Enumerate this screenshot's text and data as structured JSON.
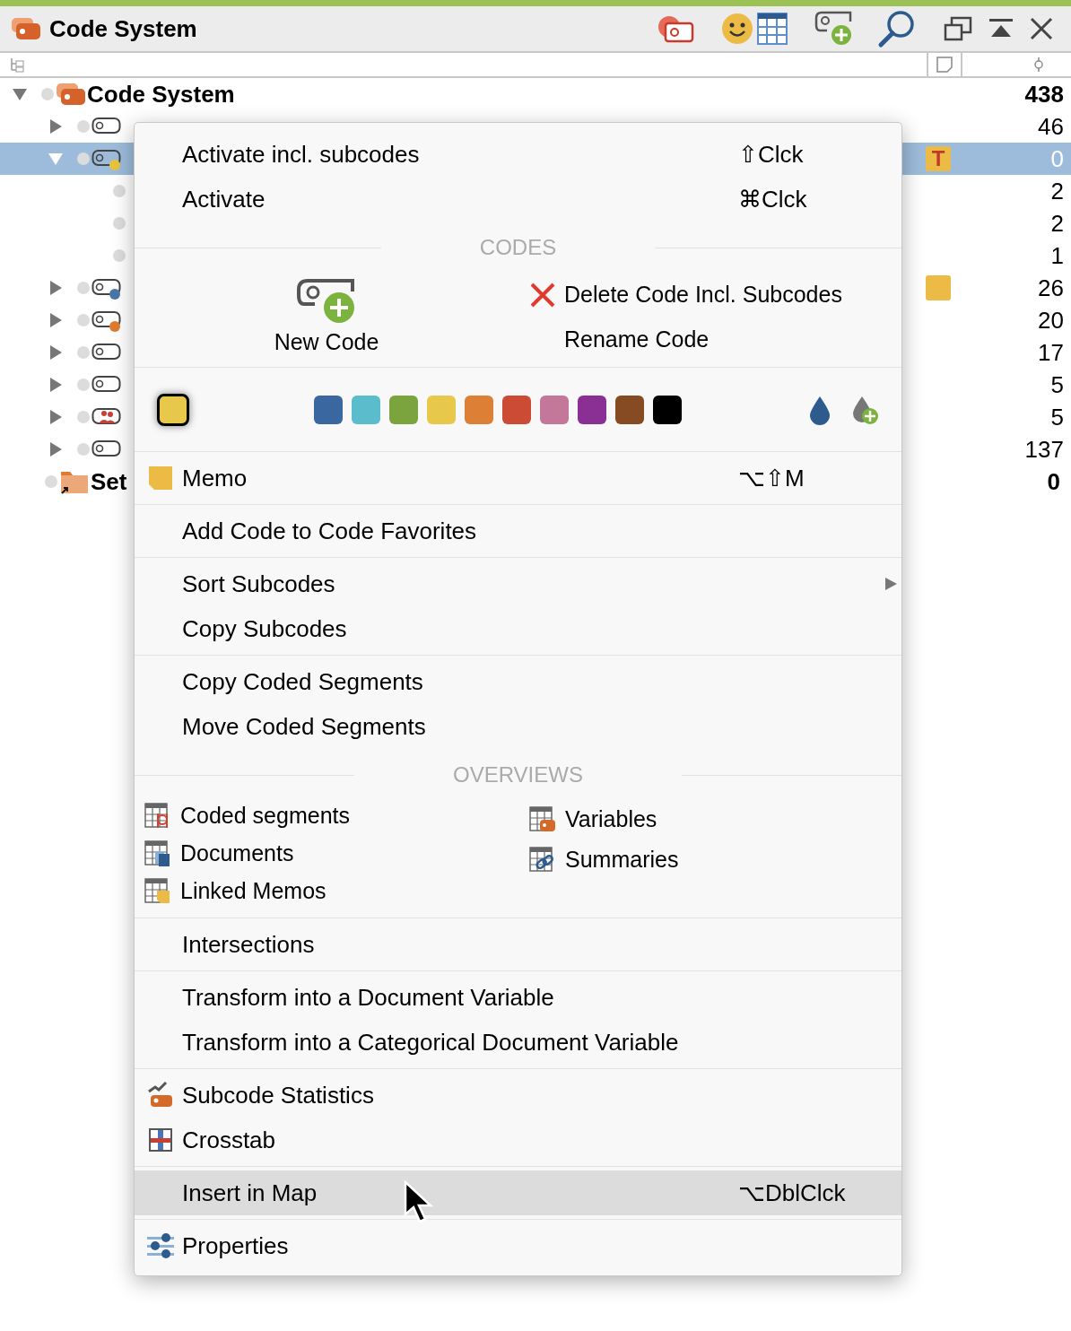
{
  "window": {
    "title": "Code System"
  },
  "tree": {
    "root": {
      "label": "Code System",
      "count": "438",
      "expanded": true,
      "selected": false,
      "children": [
        {
          "kind": "code",
          "count": "46",
          "expanded": false,
          "selected": false
        },
        {
          "kind": "code",
          "count": "0",
          "expanded": true,
          "selected": true,
          "color": "#e8c43c",
          "memo": {
            "kind": "letter",
            "label": "T"
          },
          "children": [
            {
              "count": "2",
              "selected": false
            },
            {
              "count": "2",
              "selected": false
            },
            {
              "count": "1",
              "selected": false
            }
          ]
        },
        {
          "kind": "code",
          "count": "26",
          "expanded": false,
          "selected": false,
          "color": "#4a76a8",
          "memo": {
            "kind": "plain"
          }
        },
        {
          "kind": "code",
          "count": "20",
          "expanded": false,
          "selected": false,
          "color": "#e07b2e"
        },
        {
          "kind": "code",
          "count": "17",
          "expanded": false,
          "selected": false
        },
        {
          "kind": "code",
          "count": "5",
          "expanded": false,
          "selected": false
        },
        {
          "kind": "people",
          "count": "5",
          "expanded": false,
          "selected": false
        },
        {
          "kind": "code",
          "count": "137",
          "expanded": false,
          "selected": false
        }
      ]
    },
    "sets": {
      "label": "Set",
      "count": "0"
    }
  },
  "menu": [
    {
      "kind": "items",
      "items": [
        {
          "label": "Activate incl. subcodes",
          "shortcut": "⇧Clck",
          "selected": false
        },
        {
          "label": "Activate",
          "shortcut": "⌘Clck",
          "selected": false
        }
      ]
    },
    {
      "kind": "header",
      "label": "CODES"
    },
    {
      "kind": "codes",
      "new_code": "New Code",
      "delete": "Delete Code Incl. Subcodes",
      "rename": "Rename Code"
    },
    {
      "kind": "colors",
      "current": {
        "color": "#e8c84a"
      },
      "swatches": [
        {
          "color": "#3a67a0"
        },
        {
          "color": "#5bbccb"
        },
        {
          "color": "#7ba43e"
        },
        {
          "color": "#e8c84a"
        },
        {
          "color": "#dd7f35"
        },
        {
          "color": "#cc4b35"
        },
        {
          "color": "#c37899"
        },
        {
          "color": "#8a2f93"
        },
        {
          "color": "#874b23"
        },
        {
          "color": "#000000"
        }
      ]
    },
    {
      "kind": "items",
      "items": [
        {
          "label": "Memo",
          "shortcut": "⌥⇧M",
          "kind": "memo",
          "selected": false
        }
      ]
    },
    {
      "kind": "items",
      "items": [
        {
          "label": "Add Code to Code Favorites",
          "selected": false
        }
      ]
    },
    {
      "kind": "items",
      "items": [
        {
          "label": "Sort Subcodes",
          "submenu": true,
          "selected": false
        },
        {
          "label": "Copy Subcodes",
          "selected": false
        }
      ]
    },
    {
      "kind": "items",
      "items": [
        {
          "label": "Copy Coded Segments",
          "selected": false
        },
        {
          "label": "Move Coded Segments",
          "selected": false
        }
      ]
    },
    {
      "kind": "header",
      "label": "OVERVIEWS"
    },
    {
      "kind": "overviews",
      "left": [
        {
          "label": "Coded segments",
          "kind": "segments"
        },
        {
          "label": "Documents",
          "kind": "documents"
        },
        {
          "label": "Linked Memos",
          "kind": "memos"
        }
      ],
      "right": [
        {
          "label": "Variables",
          "kind": "variables"
        },
        {
          "label": "Summaries",
          "kind": "summaries"
        }
      ]
    },
    {
      "kind": "items",
      "items": [
        {
          "label": "Intersections",
          "selected": false
        }
      ]
    },
    {
      "kind": "items",
      "items": [
        {
          "label": "Transform into a Document Variable",
          "selected": false
        },
        {
          "label": "Transform into a Categorical Document Variable",
          "selected": false
        }
      ]
    },
    {
      "kind": "items",
      "items": [
        {
          "label": "Subcode Statistics",
          "kind": "stats",
          "selected": false
        },
        {
          "label": "Crosstab",
          "kind": "crosstab",
          "selected": false
        }
      ]
    },
    {
      "kind": "items",
      "items": [
        {
          "label": "Insert in Map",
          "shortcut": "⌥DblClck",
          "selected": true
        }
      ]
    },
    {
      "kind": "items",
      "items": [
        {
          "label": "Properties",
          "kind": "properties",
          "selected": false
        }
      ]
    }
  ]
}
